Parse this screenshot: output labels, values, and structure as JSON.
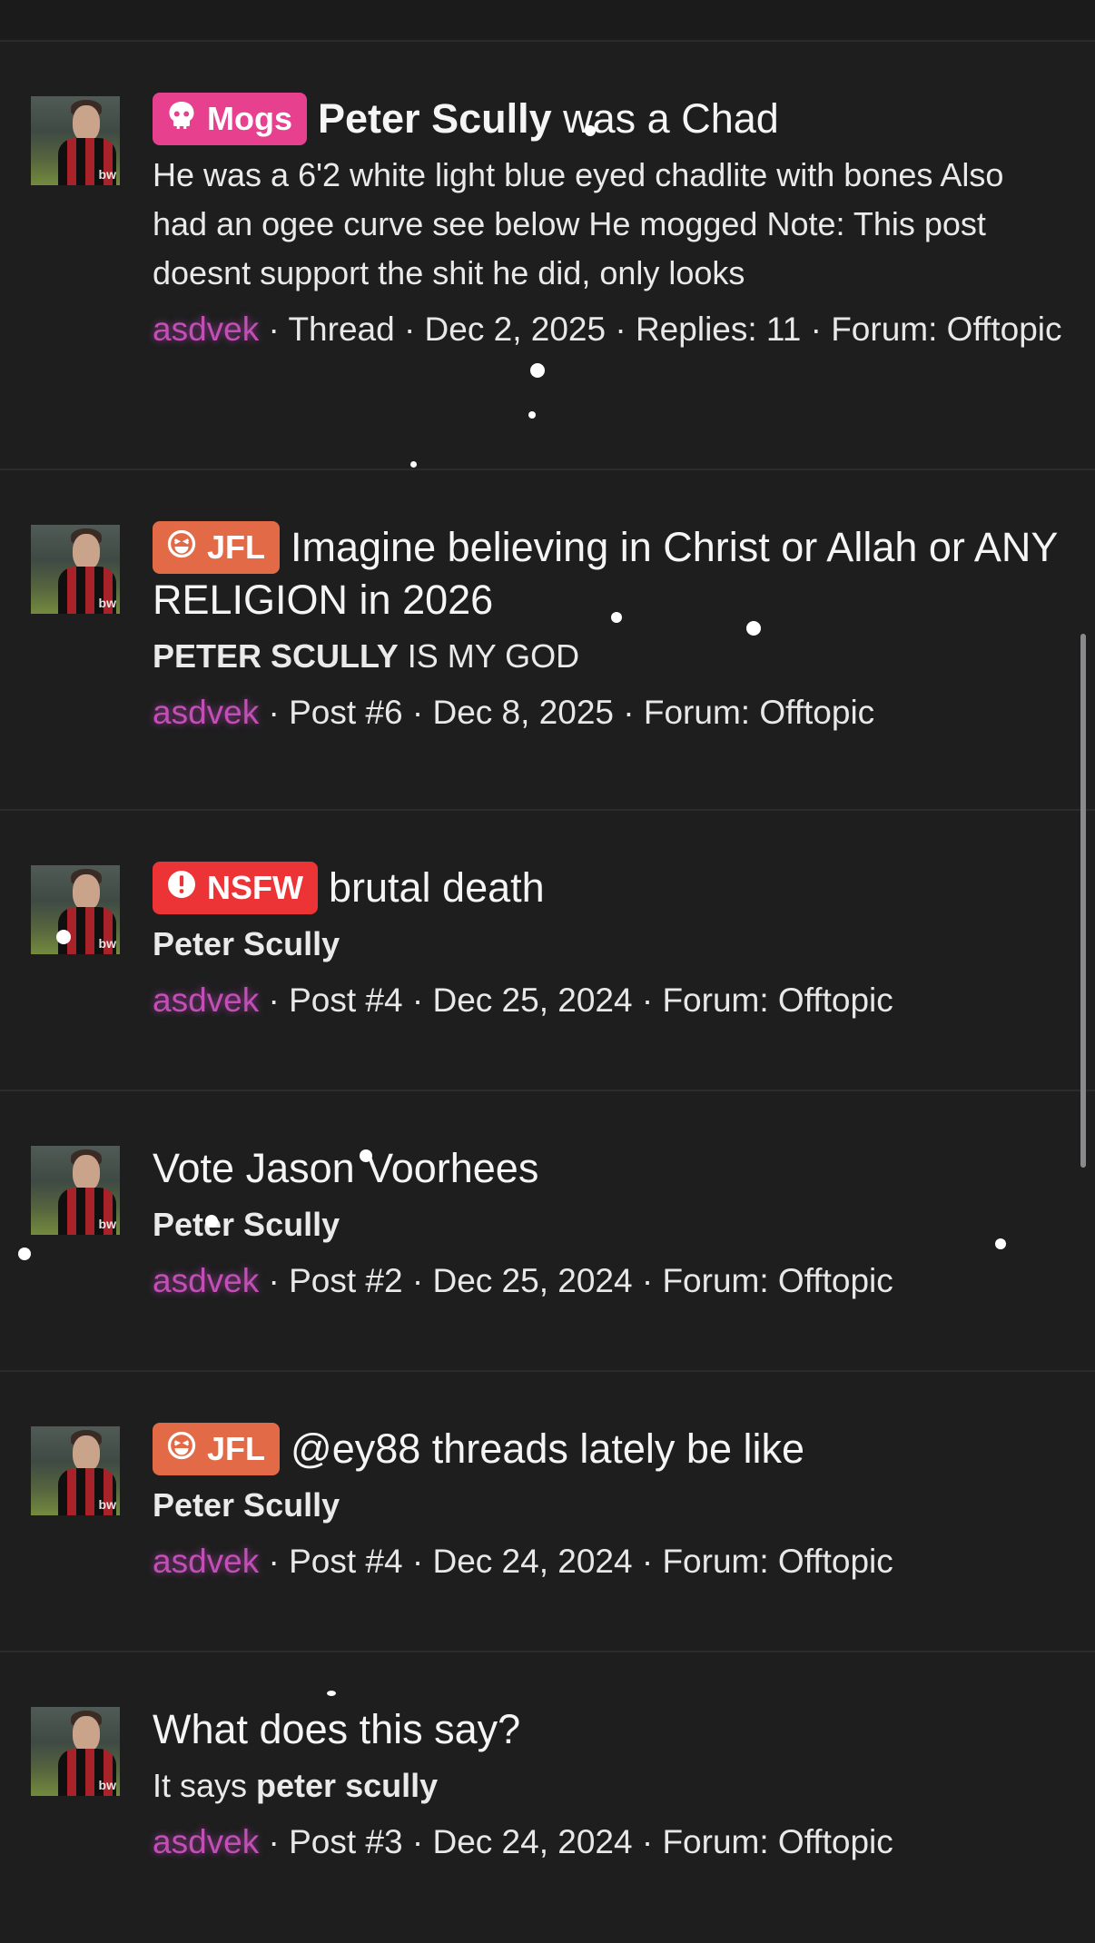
{
  "results": [
    {
      "badge": {
        "label": "Mogs",
        "icon": "skull-icon",
        "color": "#e6408e"
      },
      "title_bold": "Peter Scully",
      "title": " was a Chad",
      "snippet_bold": "",
      "snippet": "He was a 6'2 white light blue eyed chadlite with bones Also had an ogee curve see below He mogged Note: This post doesnt support the shit he did, only looks",
      "meta": {
        "user": "asdvek",
        "rest": " · Thread · Dec 2, 2025 · Replies: 11 · Forum: Offtopic"
      }
    },
    {
      "badge": {
        "label": "JFL",
        "icon": "laugh-icon",
        "color": "#e26a47"
      },
      "title_bold": "",
      "title": "Imagine believing in Christ or Allah or ANY RELIGION in 2026",
      "snippet_bold": "PETER SCULLY",
      "snippet": " IS MY GOD",
      "meta": {
        "user": "asdvek",
        "rest": " · Post #6 · Dec 8, 2025 · Forum: Offtopic"
      }
    },
    {
      "badge": {
        "label": "NSFW",
        "icon": "alert-icon",
        "color": "#ec3336"
      },
      "title_bold": "",
      "title": "brutal death",
      "snippet_bold": "Peter Scully",
      "snippet": "",
      "meta": {
        "user": "asdvek",
        "rest": " · Post #4 · Dec 25, 2024 · Forum: Offtopic"
      }
    },
    {
      "badge": null,
      "title_bold": "",
      "title": "Vote Jason Voorhees",
      "snippet_bold": "Peter Scully",
      "snippet": "",
      "meta": {
        "user": "asdvek",
        "rest": " · Post #2 · Dec 25, 2024 · Forum: Offtopic"
      }
    },
    {
      "badge": {
        "label": "JFL",
        "icon": "laugh-icon",
        "color": "#e26a47"
      },
      "title_bold": "",
      "title": "@ey88 threads lately be like",
      "snippet_bold": "Peter Scully",
      "snippet": "",
      "meta": {
        "user": "asdvek",
        "rest": " · Post #4 · Dec 24, 2024 · Forum: Offtopic"
      }
    },
    {
      "badge": null,
      "title_bold": "",
      "title": "What does this say?",
      "snippet_pre": "It says ",
      "snippet_bold": "peter scully",
      "snippet": "",
      "meta": {
        "user": "asdvek",
        "rest": " · Post #3 · Dec 24, 2024 · Forum: Offtopic"
      }
    }
  ],
  "avatar_mark": "bw",
  "colors": {
    "background": "#1e1e1f",
    "username": "#c24fb6",
    "divider": "#2b2b2d"
  }
}
